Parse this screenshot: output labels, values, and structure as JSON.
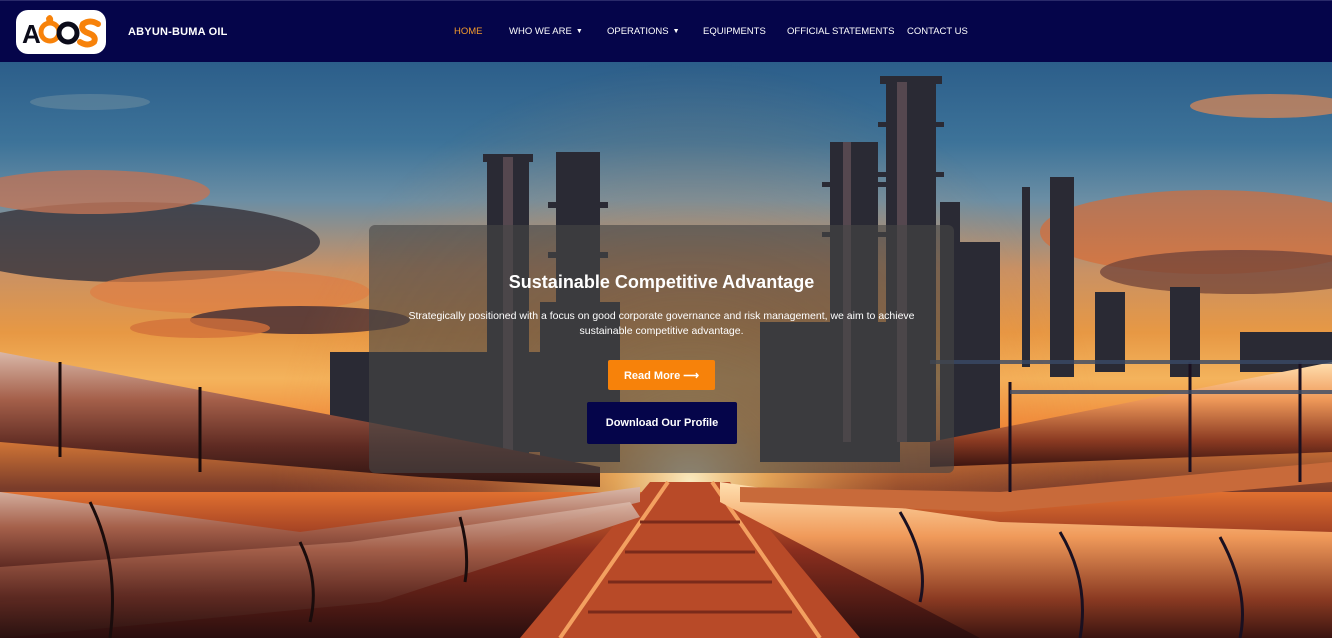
{
  "header": {
    "brand_name": "ABYUN-BUMA OIL",
    "logo_text": "ABOS",
    "nav": [
      {
        "label": "HOME",
        "active": true,
        "has_dropdown": false
      },
      {
        "label": "WHO WE ARE",
        "active": false,
        "has_dropdown": true
      },
      {
        "label": "OPERATIONS",
        "active": false,
        "has_dropdown": true
      },
      {
        "label": "EQUIPMENTS",
        "active": false,
        "has_dropdown": false
      },
      {
        "label": "OFFICIAL STATEMENTS",
        "active": false,
        "has_dropdown": false
      },
      {
        "label": "CONTACT US",
        "active": false,
        "has_dropdown": false
      }
    ],
    "dropdown_icon": "caret-down-icon"
  },
  "hero": {
    "title": "Sustainable Competitive Advantage",
    "text": "Strategically positioned with a focus on good corporate governance and risk management, we aim to achieve sustainable competitive advantage.",
    "read_more_label": "Read More ⟶",
    "download_label": "Download Our Profile",
    "background_image": "oil refinery with pipelines at sunset"
  },
  "colors": {
    "header_bg": "#05054a",
    "accent_orange": "#f7820a",
    "nav_active": "#f39a2c",
    "download_btn": "#05054a"
  }
}
